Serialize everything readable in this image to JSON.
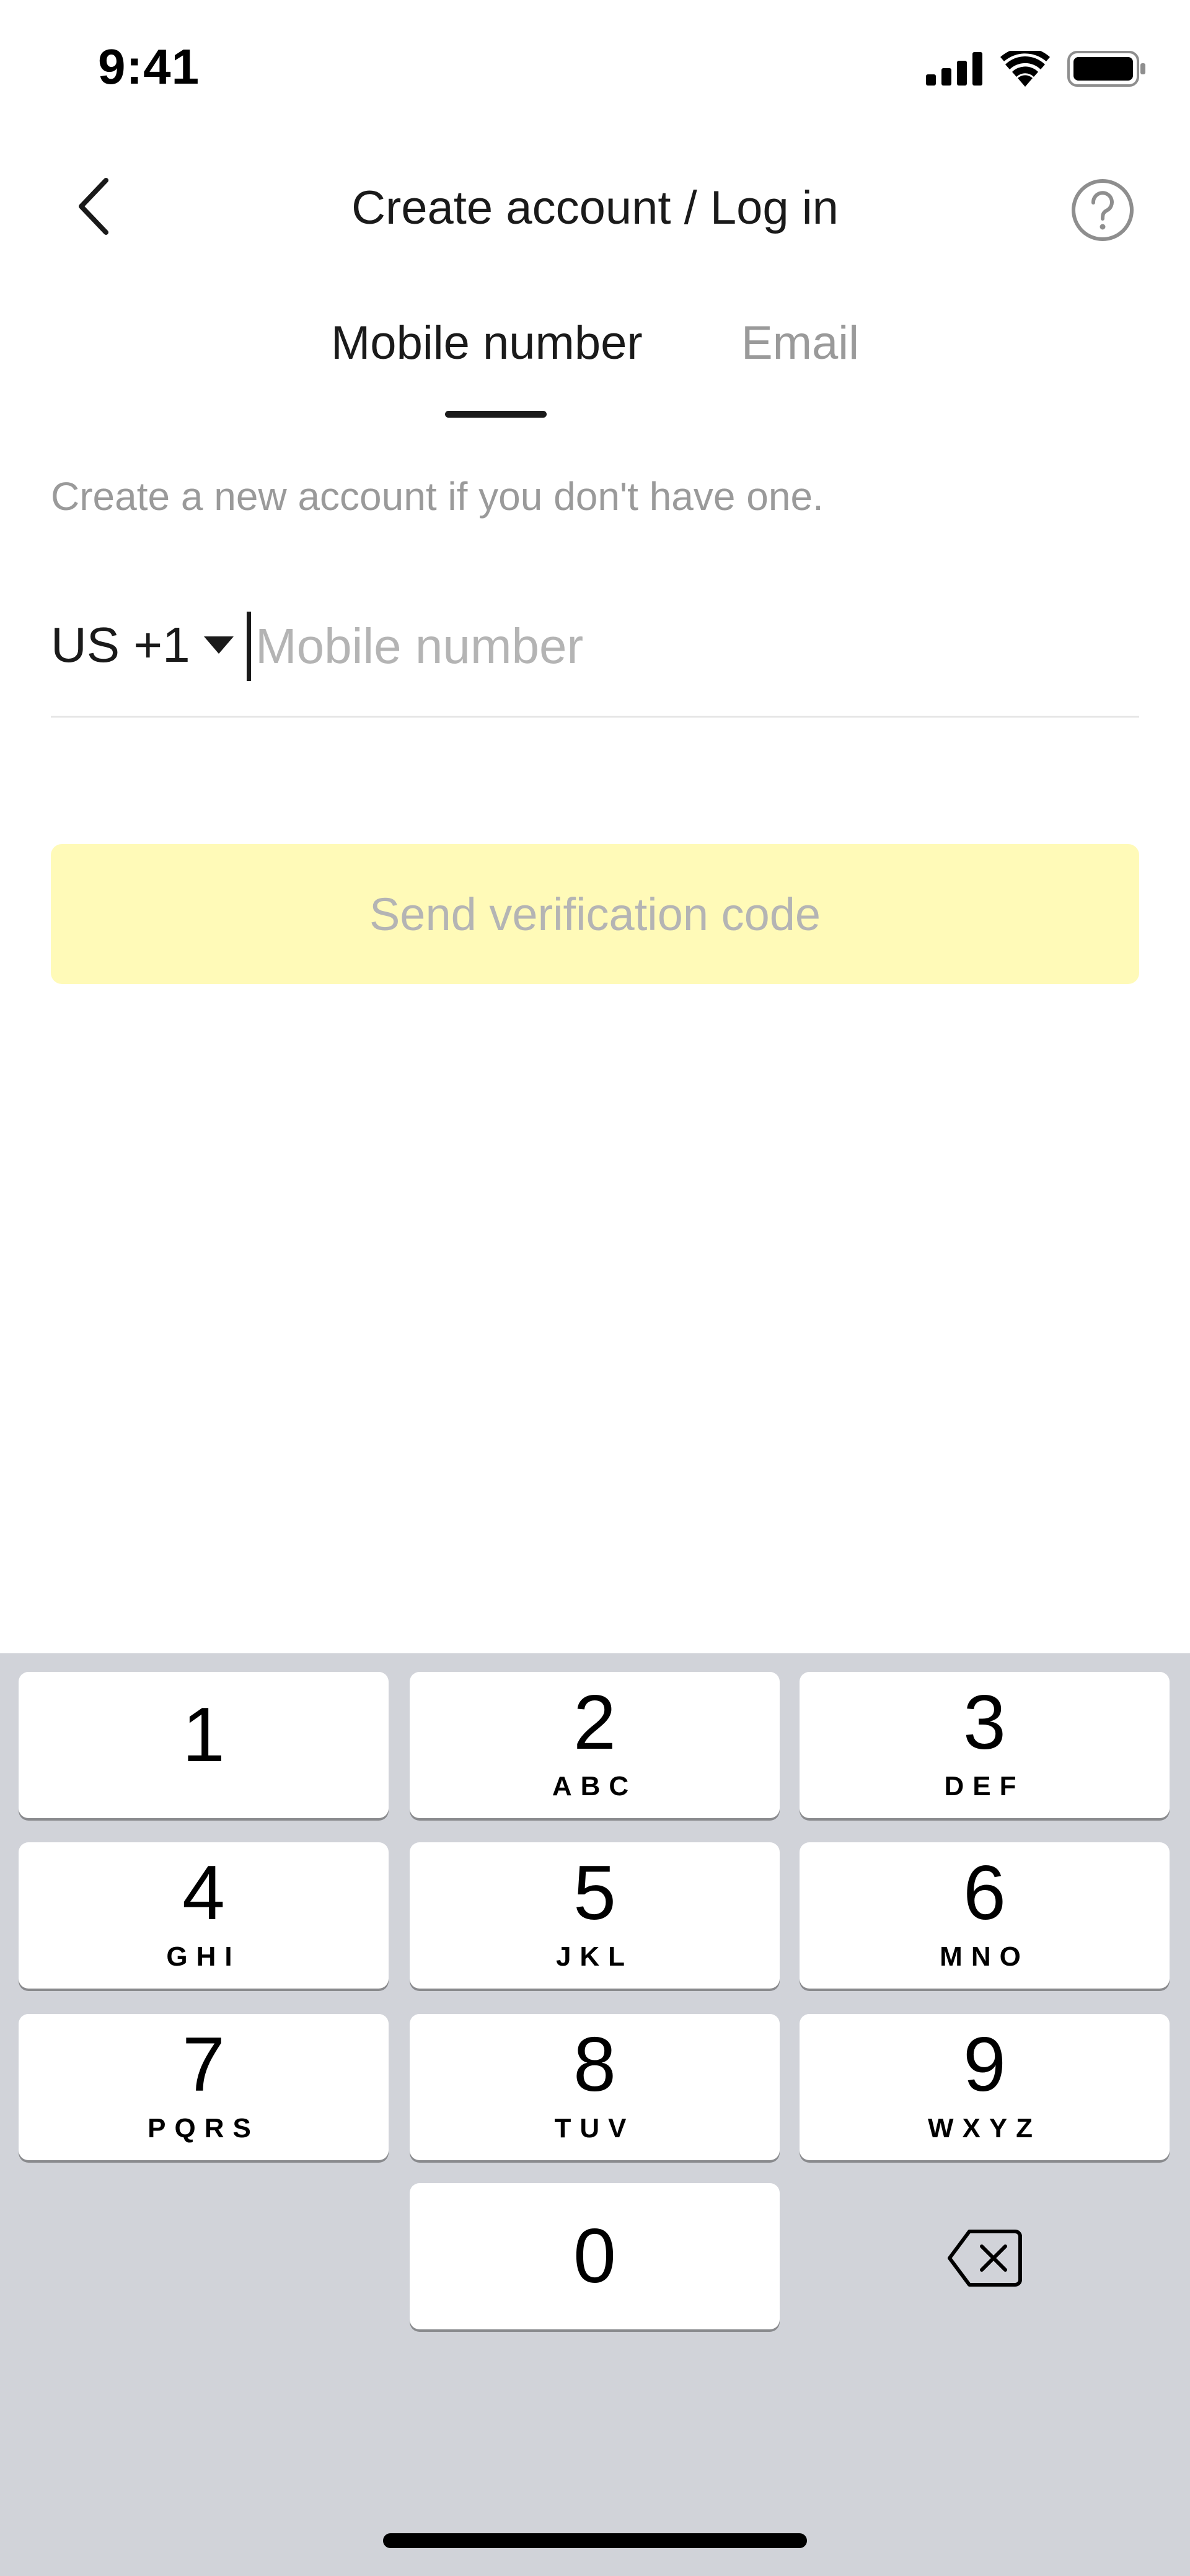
{
  "status_bar": {
    "time": "9:41",
    "icons": [
      "cellular-signal-icon",
      "wifi-icon",
      "battery-icon"
    ]
  },
  "header": {
    "title": "Create account / Log in",
    "back_icon": "chevron-left-icon",
    "help_icon": "help-circle-icon"
  },
  "tabs": [
    {
      "label": "Mobile number",
      "active": true
    },
    {
      "label": "Email",
      "active": false
    }
  ],
  "helper_text": "Create a new account if you don't have one.",
  "phone_input": {
    "country_code": "US +1",
    "value": "",
    "placeholder": "Mobile number"
  },
  "send_button": {
    "label": "Send verification code",
    "enabled": false
  },
  "keypad": {
    "keys": [
      {
        "digit": "1",
        "letters": ""
      },
      {
        "digit": "2",
        "letters": "ABC"
      },
      {
        "digit": "3",
        "letters": "DEF"
      },
      {
        "digit": "4",
        "letters": "GHI"
      },
      {
        "digit": "5",
        "letters": "JKL"
      },
      {
        "digit": "6",
        "letters": "MNO"
      },
      {
        "digit": "7",
        "letters": "PQRS"
      },
      {
        "digit": "8",
        "letters": "TUV"
      },
      {
        "digit": "9",
        "letters": "WXYZ"
      },
      {
        "digit": "0",
        "letters": ""
      }
    ],
    "backspace_icon": "backspace-icon"
  },
  "colors": {
    "button_disabled_bg": "#fffab8",
    "text_primary": "#1a1a1a",
    "text_muted": "#9a9a9a",
    "keyboard_bg": "#d1d3d9"
  }
}
